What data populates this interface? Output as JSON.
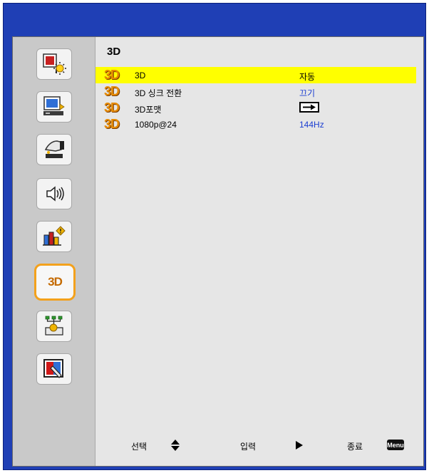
{
  "menu": {
    "title": "3D",
    "sidebar": {
      "active_label": "3D"
    },
    "items": [
      {
        "badge": "3D",
        "label": "3D",
        "value": "자동",
        "selected": true
      },
      {
        "badge": "3D",
        "label": "3D 싱크 전환",
        "value": "끄기",
        "selected": false
      },
      {
        "badge": "3D",
        "label": "3D포맷",
        "value_icon": "right-arrow-box-icon",
        "selected": false
      },
      {
        "badge": "3D",
        "label": "1080p@24",
        "value": "144Hz",
        "selected": false
      }
    ],
    "footer": {
      "select_label": "선택",
      "enter_label": "입력",
      "exit_label": "종료",
      "menu_key": "Menu"
    }
  },
  "colors": {
    "frame": "#1f3fb5",
    "panel": "#e6e6e6",
    "sidebar": "#c9c9c9",
    "highlight": "#ffff00",
    "value_text": "#1a3dd1",
    "active_border": "#f3a11c"
  }
}
